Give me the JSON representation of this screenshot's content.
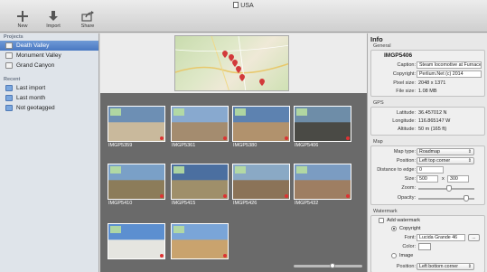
{
  "window": {
    "title": "USA"
  },
  "toolbar": {
    "new_label": "New",
    "import_label": "Import",
    "share_label": "Share"
  },
  "sidebar": {
    "projects_header": "Projects",
    "projects": [
      {
        "label": "Death Valley",
        "selected": true
      },
      {
        "label": "Monument Valley"
      },
      {
        "label": "Grand Canyon"
      }
    ],
    "recent_header": "Recent",
    "recent": [
      {
        "label": "Last import"
      },
      {
        "label": "Last month"
      },
      {
        "label": "Not geotagged"
      }
    ]
  },
  "map": {
    "label": ""
  },
  "photos": [
    {
      "name": "IMGP5359",
      "colors": [
        "#6d8fb4",
        "#c9b99c"
      ]
    },
    {
      "name": "IMGP5361",
      "colors": [
        "#88a9cf",
        "#a48c6f"
      ]
    },
    {
      "name": "IMGP5380",
      "colors": [
        "#5d82b0",
        "#b1926d"
      ]
    },
    {
      "name": "IMGP5406",
      "colors": [
        "#6e8da8",
        "#4a4a45"
      ]
    },
    {
      "name": "IMGP5410",
      "colors": [
        "#7aa0c7",
        "#8c7c5a"
      ]
    },
    {
      "name": "IMGP5415",
      "colors": [
        "#4b6fa0",
        "#9f8f6a"
      ]
    },
    {
      "name": "IMGP5426",
      "colors": [
        "#8aa9c5",
        "#8b7358"
      ]
    },
    {
      "name": "IMGP5432",
      "colors": [
        "#7b9cc2",
        "#9e7e62"
      ]
    },
    {
      "name": "",
      "colors": [
        "#5c8fd0",
        "#e5e5e0"
      ]
    },
    {
      "name": "",
      "colors": [
        "#7aa5d8",
        "#c9a36e"
      ]
    }
  ],
  "inspector": {
    "title": "Info",
    "general": {
      "header": "General",
      "filename": "IMGP5406",
      "caption_label": "Caption:",
      "caption_value": "Steam locomotive at Furnace",
      "copyright_label": "Copyright:",
      "copyright_value": "Perlium.Net (c) 2014",
      "pixel_size_label": "Pixel size:",
      "pixel_size_value": "2048 x 1371",
      "file_size_label": "File size:",
      "file_size_value": "1.08 MB"
    },
    "gps": {
      "header": "GPS",
      "lat_label": "Latitude:",
      "lat_value": "36.457012 N",
      "lon_label": "Longitude:",
      "lon_value": "116.865147 W",
      "alt_label": "Altitude:",
      "alt_value": "50 m (165 ft)"
    },
    "map": {
      "header": "Map",
      "type_label": "Map type:",
      "type_value": "Roadmap",
      "position_label": "Position:",
      "position_value": "Left top corner",
      "distance_label": "Distance to edge:",
      "distance_value": "0",
      "size_label": "Size:",
      "size_w": "500",
      "size_x": "x",
      "size_h": "300",
      "zoom_label": "Zoom:",
      "zoom_level": 0.55,
      "opacity_label": "Opacity:",
      "opacity_level": 0.9
    },
    "watermark": {
      "header": "Watermark",
      "add_label": "Add watermark",
      "copyright_label": "Copyright",
      "font_label": "Font:",
      "font_value": "Lucida Grande 46",
      "font_button": "...",
      "color_label": "Color:",
      "image_label": "Image",
      "position_label": "Position:",
      "position_value": "Left bottom corner"
    }
  }
}
